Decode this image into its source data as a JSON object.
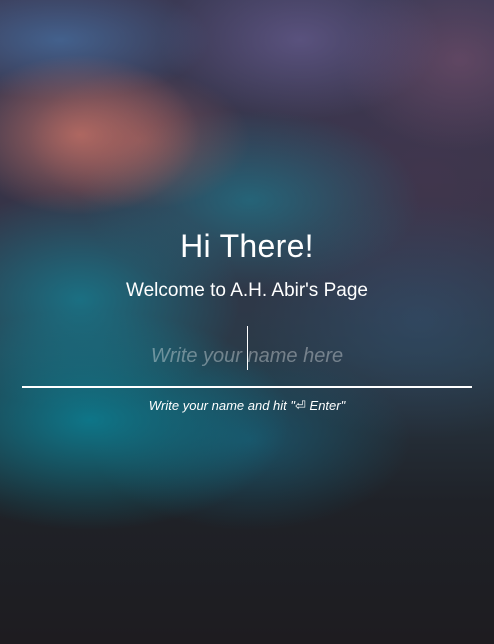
{
  "greeting": {
    "title": "Hi There!",
    "subtitle": "Welcome to A.H. Abir's Page"
  },
  "name_form": {
    "input_placeholder": "Write your name here",
    "input_value": "",
    "hint": "Write your name and hit \"⏎ Enter\""
  },
  "colors": {
    "text": "#ffffff",
    "underline": "#ffffff",
    "background_dark": "#1e1c20",
    "accent_teal": "#14828f",
    "accent_rose": "#be6e64"
  }
}
